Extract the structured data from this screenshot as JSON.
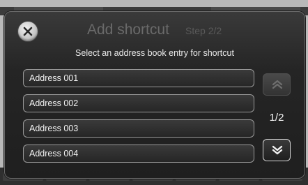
{
  "dialog": {
    "title": "Add shortcut",
    "step": "Step 2/2",
    "instruction": "Select an address book entry for shortcut"
  },
  "entries": [
    {
      "label": "Address 001"
    },
    {
      "label": "Address 002"
    },
    {
      "label": "Address 003"
    },
    {
      "label": "Address 004"
    }
  ],
  "pager": {
    "indicator": "1/2",
    "up_icon": "chevron-double-up-icon",
    "down_icon": "chevron-double-down-icon"
  },
  "icons": {
    "close": "close-icon"
  },
  "colors": {
    "dialog_bg": "#252525",
    "item_border": "#9a9a9a",
    "text": "#f2f2f2",
    "title_dim": "#6a6a6a"
  }
}
